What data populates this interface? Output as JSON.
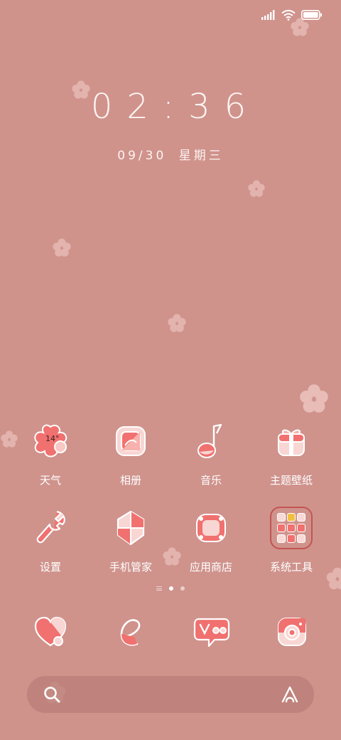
{
  "status_bar": {
    "signal_icon": "signal-bars-icon",
    "wifi_icon": "wifi-icon",
    "battery_icon": "battery-icon",
    "battery_level": 1.0
  },
  "lockclock": {
    "time": "02:36",
    "date": "09/30",
    "weekday": "星期三"
  },
  "apps_row1": [
    {
      "label": "天气",
      "icon": "weather-flower-icon",
      "badge": "14°"
    },
    {
      "label": "相册",
      "icon": "gallery-icon"
    },
    {
      "label": "音乐",
      "icon": "music-note-icon"
    },
    {
      "label": "主题壁纸",
      "icon": "theme-gift-icon"
    }
  ],
  "apps_row2": [
    {
      "label": "设置",
      "icon": "wrench-settings-icon"
    },
    {
      "label": "手机管家",
      "icon": "shield-security-icon"
    },
    {
      "label": "应用商店",
      "icon": "app-store-icon"
    },
    {
      "label": "系统工具",
      "icon": "folder-icon"
    }
  ],
  "pages": {
    "count": 2,
    "active": 1
  },
  "dock": [
    {
      "name": "phone",
      "icon": "heart-phone-icon"
    },
    {
      "name": "browser",
      "icon": "browser-e-icon"
    },
    {
      "name": "messages",
      "icon": "chat-bubble-icon"
    },
    {
      "name": "camera",
      "icon": "camera-icon"
    }
  ],
  "search": {
    "search_icon": "search-icon",
    "assistant_icon": "assistant-a-icon"
  },
  "colors": {
    "background": "#cf938c",
    "accent": "#f0716f",
    "folder_border": "#c25552"
  }
}
